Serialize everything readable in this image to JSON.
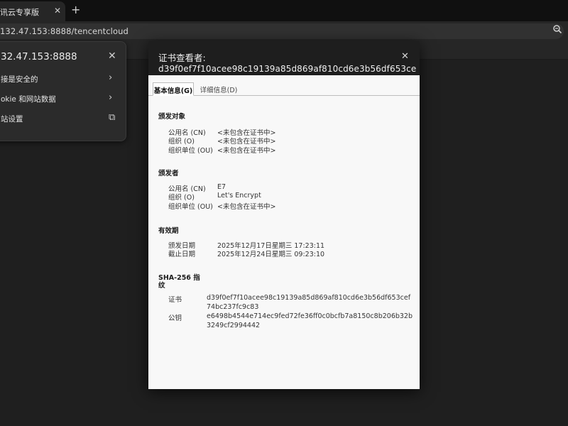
{
  "browser": {
    "tab_title": "讯云专享版",
    "tab_close": "✕",
    "new_tab": "+",
    "url": "132.47.153:8888/tencentcloud"
  },
  "site_popup": {
    "host": "32.47.153:8888",
    "close": "✕",
    "rows": [
      {
        "label": "接是安全的",
        "icon": "›"
      },
      {
        "label": "okie 和网站数据",
        "icon": "›"
      },
      {
        "label": "站设置",
        "icon": "⧉"
      }
    ]
  },
  "cert_dialog": {
    "title": "证书查看者:",
    "subtitle": "d39f0ef7f10acee98c19139a85d869af810cd6e3b56df653ce",
    "close": "✕",
    "tabs": [
      {
        "label": "基本信息(G)",
        "active": true
      },
      {
        "label": "详细信息(D)",
        "active": false
      }
    ],
    "issued_to": {
      "title": "颁发对象",
      "rows": [
        {
          "key": "公用名 (CN)",
          "value": "<未包含在证书中>"
        },
        {
          "key": "组织 (O)",
          "value": "<未包含在证书中>"
        },
        {
          "key": "组织单位 (OU)",
          "value": "<未包含在证书中>"
        }
      ]
    },
    "issued_by": {
      "title": "颁发者",
      "rows": [
        {
          "key": "公用名 (CN)",
          "value": "E7"
        },
        {
          "key": "组织 (O)",
          "value": "Let's Encrypt"
        },
        {
          "key": "组织单位 (OU)",
          "value": "<未包含在证书中>"
        }
      ]
    },
    "validity": {
      "title": "有效期",
      "rows": [
        {
          "key": "颁发日期",
          "value": "2025年12月17日星期三 17:23:11"
        },
        {
          "key": "截止日期",
          "value": "2025年12月24日星期三 09:23:10"
        }
      ]
    },
    "fingerprints": {
      "title_line1": "SHA-256 指",
      "title_line2": "纹",
      "rows": [
        {
          "key": "证书",
          "value": "d39f0ef7f10acee98c19139a85d869af810cd6e3b56df653cef74bc237fc9c83"
        },
        {
          "key": "公钥",
          "value": "e6498b4544e714ec9fed72fe36ff0c0bcfb7a8150c8b206b32b3249cf2994442"
        }
      ]
    }
  }
}
